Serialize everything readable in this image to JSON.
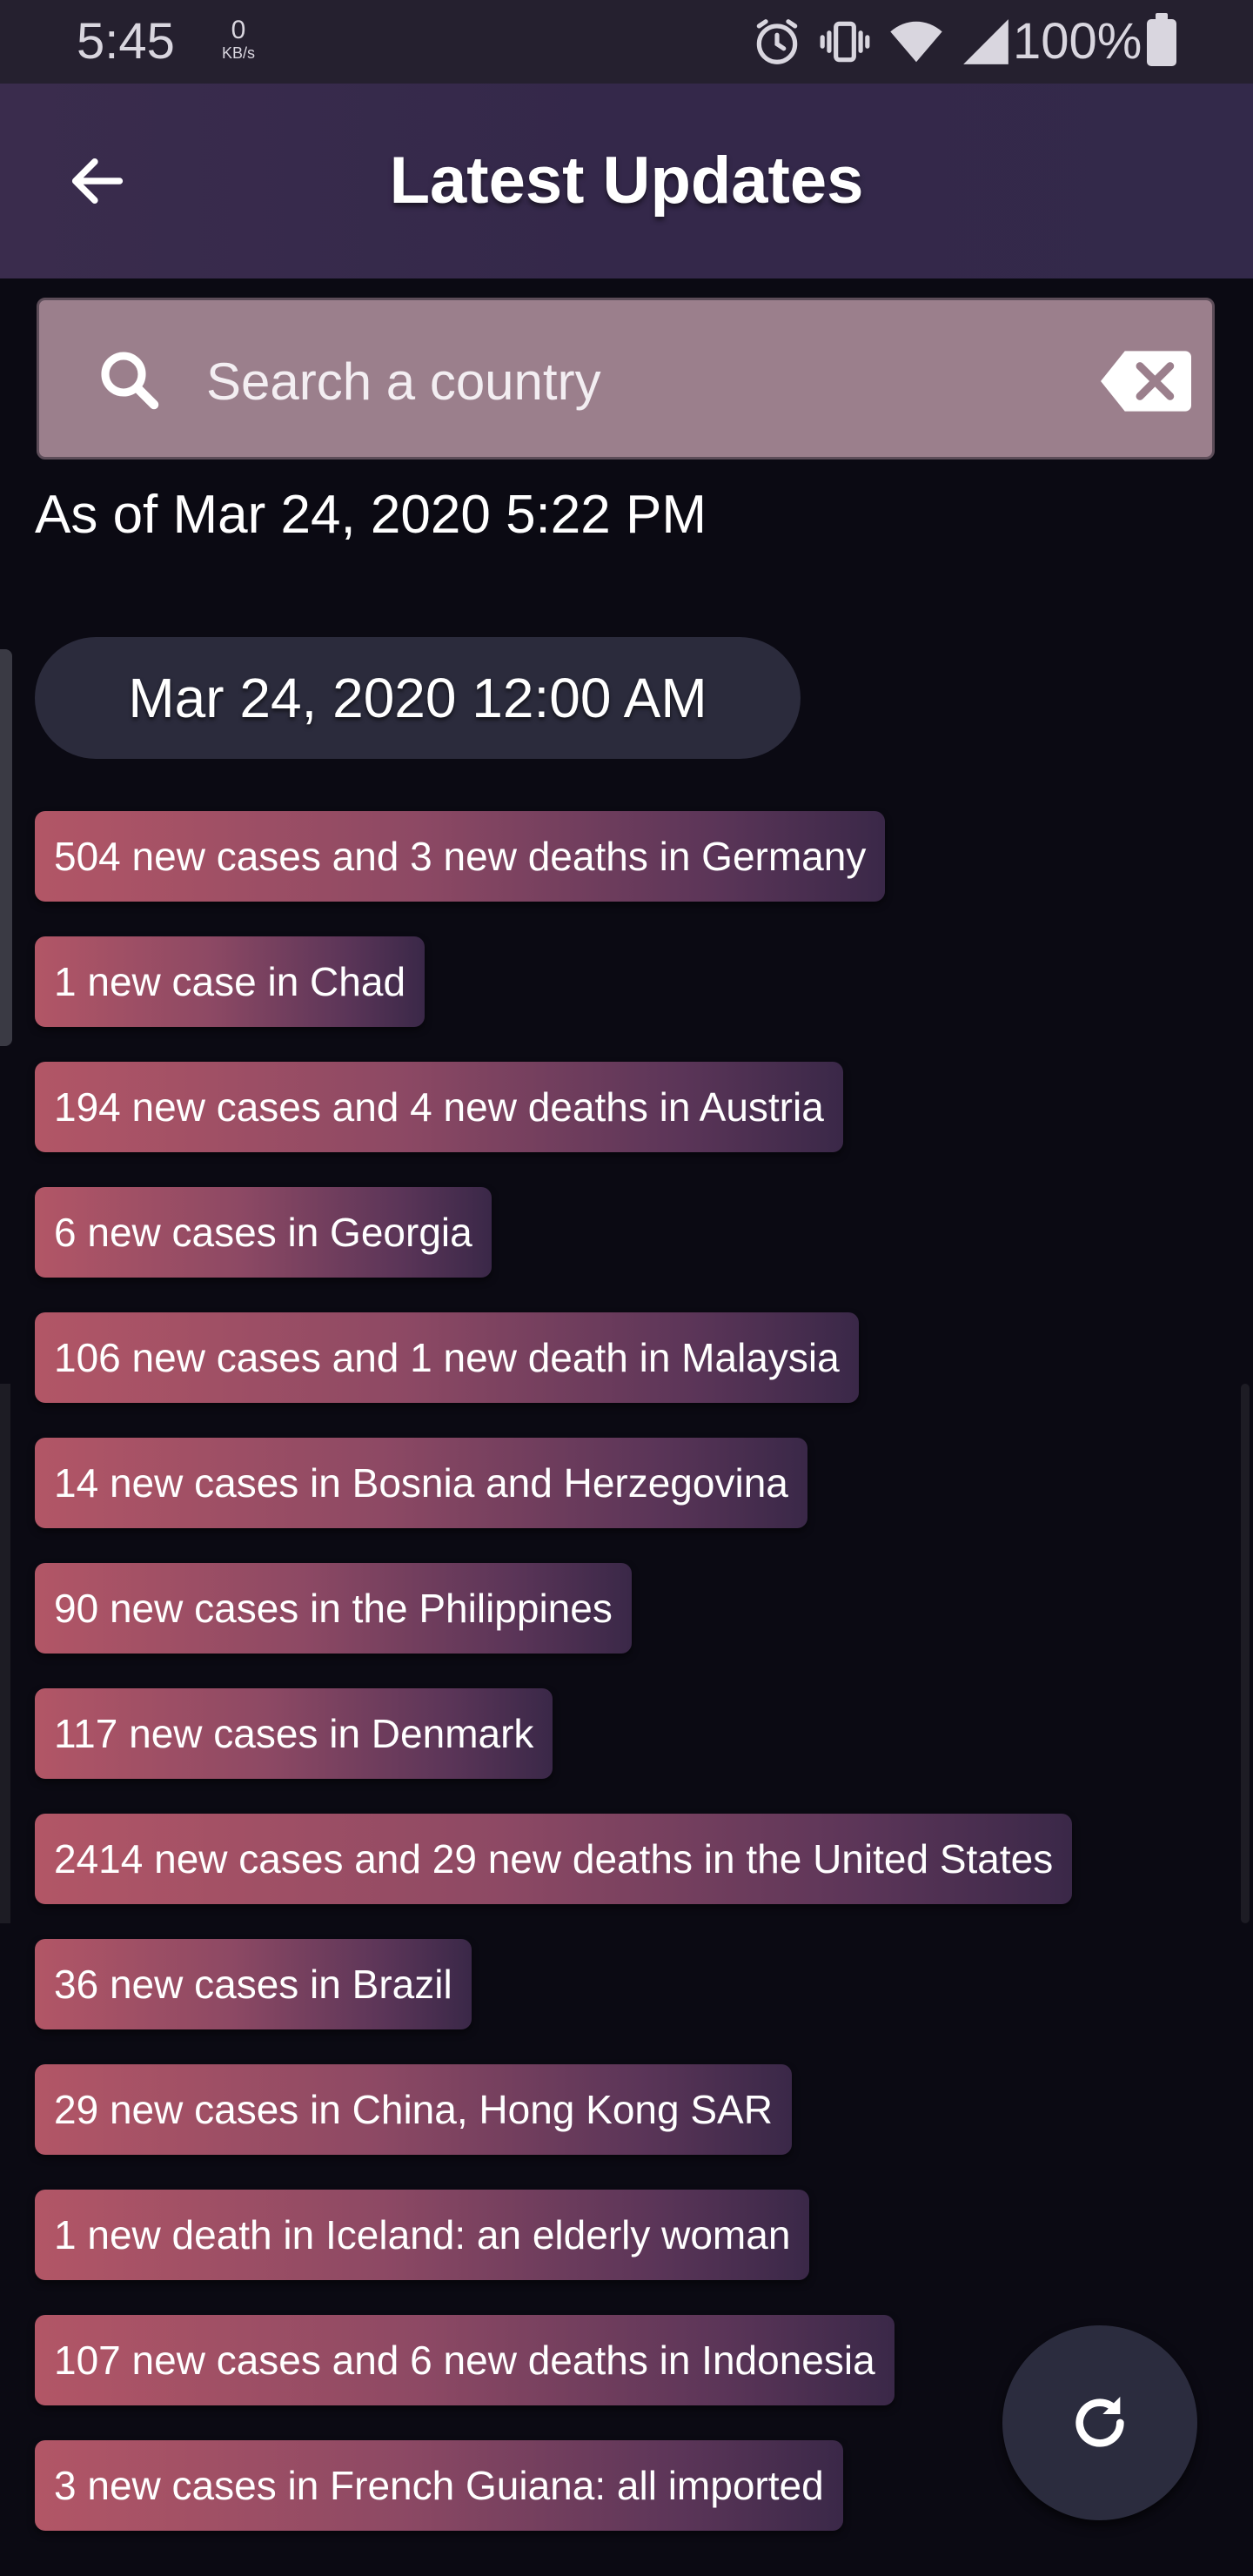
{
  "status_bar": {
    "time": "5:45",
    "net_speed_value": "0",
    "net_speed_unit": "KB/s",
    "battery_percent": "100%",
    "icons": [
      "alarm-icon",
      "vibrate-icon",
      "wifi-icon",
      "signal-icon",
      "battery-icon"
    ]
  },
  "app_bar": {
    "title": "Latest Updates",
    "back_icon": "arrow-left-icon"
  },
  "search": {
    "placeholder": "Search a country",
    "value": ""
  },
  "as_of": "As of Mar 24, 2020 5:22 PM",
  "date_group": "Mar 24, 2020 12:00 AM",
  "updates": [
    "504 new cases and 3 new deaths in Germany",
    "1 new case in Chad",
    "194 new cases and 4 new deaths in Austria",
    "6 new cases in Georgia",
    "106 new cases and 1 new death in Malaysia",
    "14 new cases in Bosnia and Herzegovina",
    "90 new cases in the Philippines",
    "117 new cases in Denmark",
    "2414 new cases and 29 new deaths in the United States",
    "36 new cases in Brazil",
    "29 new cases in China, Hong Kong SAR",
    "1 new death in Iceland: an elderly woman",
    "107 new cases and 6 new deaths in Indonesia",
    "3 new cases in French Guiana: all imported"
  ],
  "colors": {
    "background": "#0b0a13",
    "app_bar": "#3a2c4d",
    "search_bg": "#9b7f8c",
    "chip_gradient_start": "#b25666",
    "chip_gradient_end": "#3a2848",
    "fab_bg": "#2b2c3e"
  },
  "fab": {
    "icon": "refresh-icon"
  }
}
